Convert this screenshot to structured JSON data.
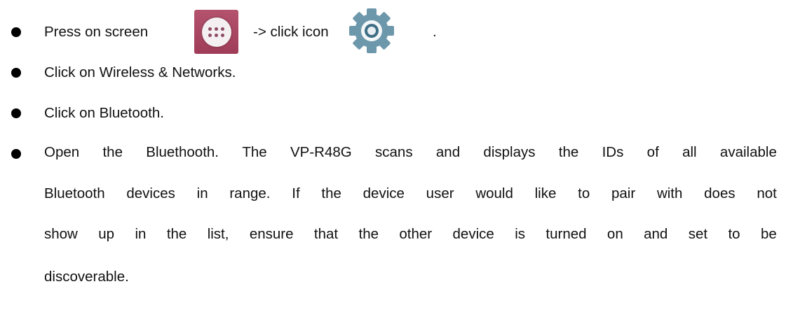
{
  "steps": [
    {
      "prefix": "Press on screen",
      "middle": "-> click icon",
      "suffix": "."
    },
    {
      "text": "Click on Wireless & Networks."
    },
    {
      "text": "Click on Bluetooth."
    },
    {
      "lines": [
        [
          "Open",
          "the",
          "Bluethooth.",
          "The",
          "VP-R48G",
          "scans",
          "and",
          "displays",
          "the",
          "IDs",
          "of",
          "all",
          "available"
        ],
        [
          "Bluetooth",
          "devices",
          "in",
          "range.",
          "If",
          "the",
          "device",
          "user",
          "would",
          "like",
          "to",
          "pair",
          "with",
          "does",
          "not"
        ],
        [
          "show",
          "up",
          "in",
          "the",
          "list,",
          "ensure",
          "that",
          "the",
          "other",
          "device",
          "is",
          "turned",
          "on",
          "and",
          "set",
          "to",
          "be"
        ]
      ],
      "last_line": "discoverable."
    }
  ],
  "icons": [
    "apps-drawer-icon",
    "settings-gear-icon"
  ],
  "colors": {
    "apps_icon_bg": "#a8445f",
    "gear": "#6b97aa"
  }
}
